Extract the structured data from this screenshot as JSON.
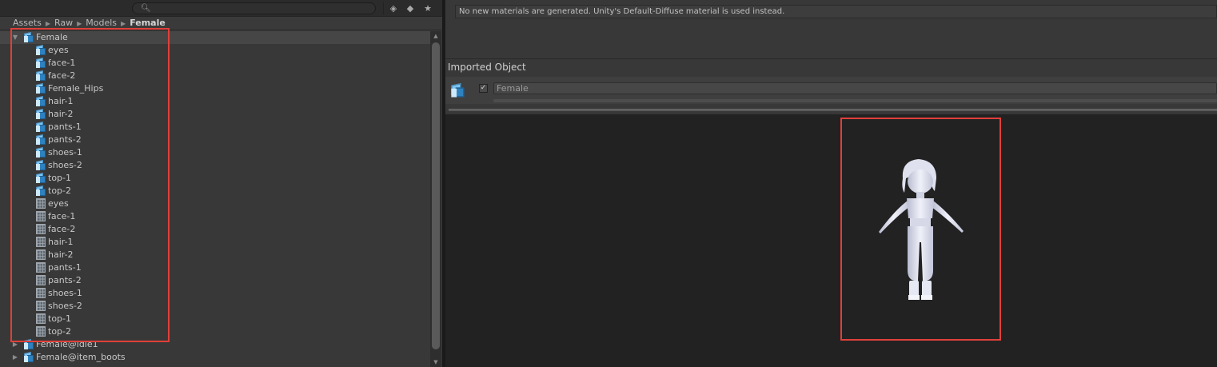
{
  "toolbar": {
    "search_icon": "search-icon",
    "buttons": [
      "filter-by-type-icon",
      "filter-by-label-icon",
      "favorites-star-icon"
    ]
  },
  "breadcrumb": {
    "items": [
      "Assets",
      "Raw",
      "Models",
      "Female"
    ]
  },
  "tree": {
    "root": {
      "label": "Female",
      "expanded": true,
      "icon": "model-prefab-icon"
    },
    "children": [
      {
        "label": "eyes",
        "icon": "gameobject-cube-icon"
      },
      {
        "label": "face-1",
        "icon": "gameobject-cube-icon"
      },
      {
        "label": "face-2",
        "icon": "gameobject-cube-icon"
      },
      {
        "label": "Female_Hips",
        "icon": "gameobject-cube-icon"
      },
      {
        "label": "hair-1",
        "icon": "gameobject-cube-icon"
      },
      {
        "label": "hair-2",
        "icon": "gameobject-cube-icon"
      },
      {
        "label": "pants-1",
        "icon": "gameobject-cube-icon"
      },
      {
        "label": "pants-2",
        "icon": "gameobject-cube-icon"
      },
      {
        "label": "shoes-1",
        "icon": "gameobject-cube-icon"
      },
      {
        "label": "shoes-2",
        "icon": "gameobject-cube-icon"
      },
      {
        "label": "top-1",
        "icon": "gameobject-cube-icon"
      },
      {
        "label": "top-2",
        "icon": "gameobject-cube-icon"
      },
      {
        "label": "eyes",
        "icon": "mesh-icon"
      },
      {
        "label": "face-1",
        "icon": "mesh-icon"
      },
      {
        "label": "face-2",
        "icon": "mesh-icon"
      },
      {
        "label": "hair-1",
        "icon": "mesh-icon"
      },
      {
        "label": "hair-2",
        "icon": "mesh-icon"
      },
      {
        "label": "pants-1",
        "icon": "mesh-icon"
      },
      {
        "label": "pants-2",
        "icon": "mesh-icon"
      },
      {
        "label": "shoes-1",
        "icon": "mesh-icon"
      },
      {
        "label": "shoes-2",
        "icon": "mesh-icon"
      },
      {
        "label": "top-1",
        "icon": "mesh-icon"
      },
      {
        "label": "top-2",
        "icon": "mesh-icon"
      }
    ],
    "siblings": [
      {
        "label": "Female@idle1",
        "icon": "model-prefab-icon",
        "expanded": false
      },
      {
        "label": "Female@item_boots",
        "icon": "model-prefab-icon",
        "expanded": false
      }
    ]
  },
  "inspector": {
    "notice": "No new materials are generated. Unity's Default-Diffuse material is used instead.",
    "section_title": "Imported Object",
    "object": {
      "name": "Female",
      "enabled": true
    }
  },
  "preview": {
    "subject": "female-character-model"
  },
  "colors": {
    "annotation": "#e0403a",
    "panel": "#383838",
    "preview_bg": "#222222"
  }
}
